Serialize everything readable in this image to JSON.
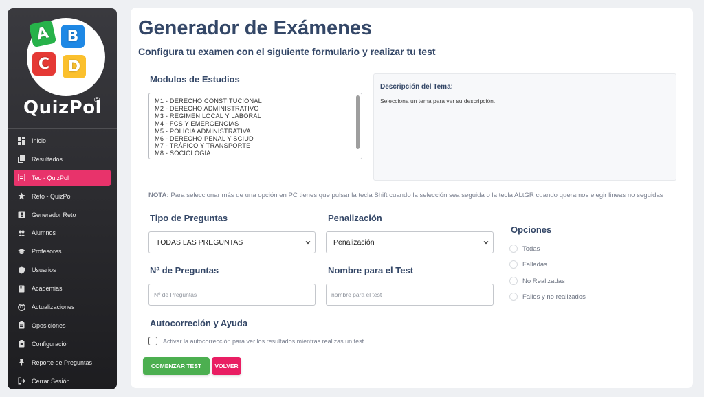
{
  "brand": {
    "name": "QuizPol",
    "copyright": "©",
    "puzzle_letters": [
      "A",
      "B",
      "C",
      "D"
    ]
  },
  "sidebar": {
    "items": [
      {
        "label": "Inicio",
        "icon": "dashboard-icon",
        "active": false
      },
      {
        "label": "Resultados",
        "icon": "copy-icon",
        "active": false
      },
      {
        "label": "Teo - QuizPol",
        "icon": "quiz-icon",
        "active": true
      },
      {
        "label": "Reto - QuizPol",
        "icon": "star-icon",
        "active": false
      },
      {
        "label": "Generador Reto",
        "icon": "quiz-box-icon",
        "active": false
      },
      {
        "label": "Alumnos",
        "icon": "group-icon",
        "active": false
      },
      {
        "label": "Profesores",
        "icon": "school-icon",
        "active": false
      },
      {
        "label": "Usuarios",
        "icon": "shield-icon",
        "active": false
      },
      {
        "label": "Academias",
        "icon": "book-icon",
        "active": false
      },
      {
        "label": "Actualizaciones",
        "icon": "face-icon",
        "active": false
      },
      {
        "label": "Oposiciones",
        "icon": "clipboard-icon",
        "active": false
      },
      {
        "label": "Configuración",
        "icon": "clipboard-settings-icon",
        "active": false
      },
      {
        "label": "Reporte de Preguntas",
        "icon": "pin-icon",
        "active": false
      },
      {
        "label": "Cerrar Sesión",
        "icon": "logout-icon",
        "active": false
      }
    ]
  },
  "main": {
    "title": "Generador de Exámenes",
    "subtitle": "Configura tu examen con el siguiente formulario y realizar tu test",
    "modules_label": "Modulos de Estudios",
    "modules": [
      "M1 - DERECHO CONSTITUCIONAL",
      "M2 - DERECHO ADMINISTRATIVO",
      "M3 - REGIMEN LOCAL Y LABORAL",
      "M4 - FCS Y EMERGENCIAS",
      "M5 - POLICIA ADMINISTRATIVA",
      "M6 - DERECHO PENAL Y SCIUD",
      "M7 - TRÁFICO Y TRANSPORTE",
      "M8 - SOCIOLOGÍA"
    ],
    "description_title": "Descripción del Tema:",
    "description_text": "Selecciona un tema para ver su descripción.",
    "note_label": "NOTA:",
    "note_text": " Para seleccionar más de una opción en PC tienes que pulsar la tecla Shift cuando la selección sea seguida o la tecla ALtGR cuando queramos elegir lineas no seguidas",
    "question_type_label": "Tipo de Preguntas",
    "question_type_value": "TODAS LAS PREGUNTAS",
    "penalty_label": "Penalización",
    "penalty_value": "Penalización",
    "num_questions_label": "Nª de Preguntas",
    "num_questions_placeholder": "Nº de Preguntas",
    "test_name_label": "Nombre para el Test",
    "test_name_placeholder": "nombre para el test",
    "options_label": "Opciones",
    "options": [
      "Todas",
      "Falladas",
      "No Realizadas",
      "Fallos y no realizados"
    ],
    "autocorrect_label": "Autocorreción y Ayuda",
    "autocorrect_text": "Activar la autocorrección para ver los resultados mientras realizas un test",
    "start_button": "COMENZAR TEST",
    "back_button": "VOLVER"
  },
  "colors": {
    "accent": "#e8336b",
    "heading": "#344767",
    "start_button": "#4caf50",
    "back_button": "#e91e63"
  }
}
